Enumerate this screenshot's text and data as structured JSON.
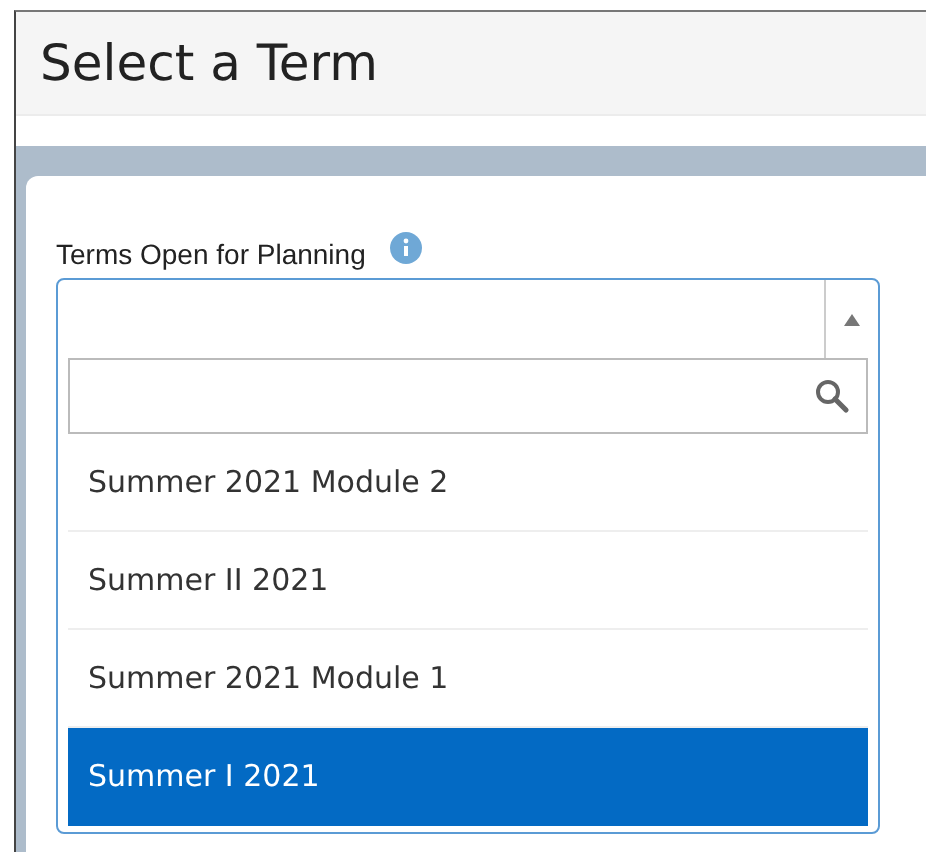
{
  "page": {
    "title": "Select a Term"
  },
  "term_select": {
    "label": "Terms Open for Planning",
    "expanded": true,
    "options": [
      {
        "label": "Summer 2021 Module 2",
        "selected": false
      },
      {
        "label": "Summer II 2021",
        "selected": false
      },
      {
        "label": "Summer 2021 Module 1",
        "selected": false
      },
      {
        "label": "Summer I 2021",
        "selected": true
      }
    ]
  }
}
